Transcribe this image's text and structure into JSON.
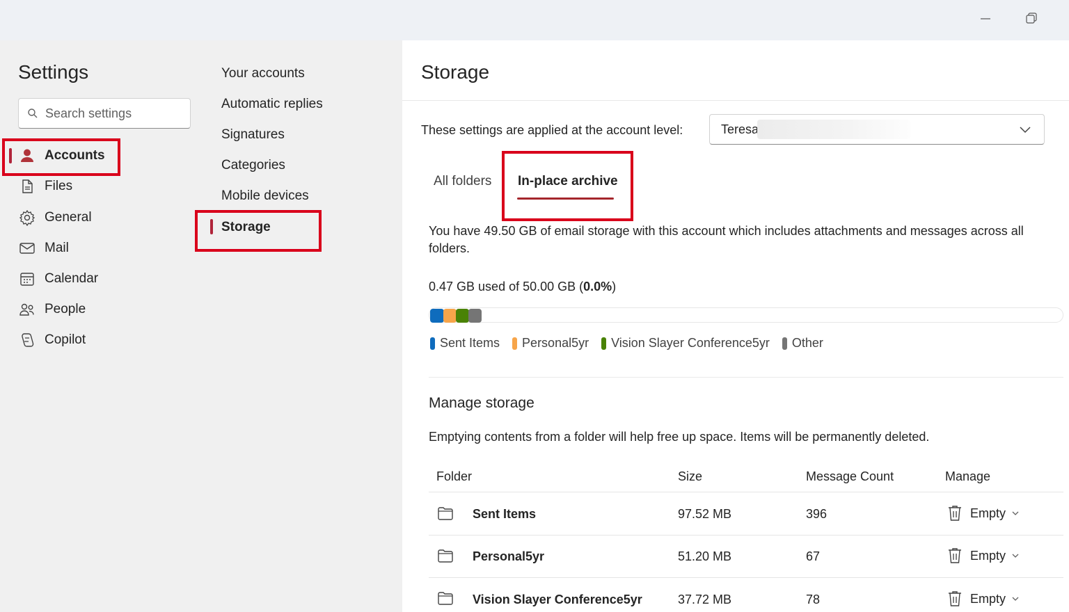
{
  "window": {
    "minimize_icon": "minimize-icon",
    "maximize_icon": "restore-icon"
  },
  "sidebar": {
    "title": "Settings",
    "search_placeholder": "Search settings",
    "items": [
      {
        "label": "Accounts",
        "icon": "person-icon",
        "selected": true
      },
      {
        "label": "Files",
        "icon": "document-icon"
      },
      {
        "label": "General",
        "icon": "gear-icon"
      },
      {
        "label": "Mail",
        "icon": "mail-icon"
      },
      {
        "label": "Calendar",
        "icon": "calendar-icon"
      },
      {
        "label": "People",
        "icon": "people-icon"
      },
      {
        "label": "Copilot",
        "icon": "copilot-icon"
      }
    ]
  },
  "subnav": {
    "items": [
      {
        "label": "Your accounts"
      },
      {
        "label": "Automatic replies"
      },
      {
        "label": "Signatures"
      },
      {
        "label": "Categories"
      },
      {
        "label": "Mobile devices"
      },
      {
        "label": "Storage",
        "selected": true
      }
    ]
  },
  "main": {
    "title": "Storage",
    "account_label": "These settings are applied at the account level:",
    "account_value": "Teresa",
    "tabs": [
      {
        "label": "All folders"
      },
      {
        "label": "In-place archive",
        "selected": true
      }
    ],
    "description": "You have 49.50 GB of email storage with this account which includes attachments and messages across all folders.",
    "usage": {
      "prefix": "0.47 GB used of 50.00 GB (",
      "percent": "0.0%",
      "suffix": ")"
    },
    "usage_bar": {
      "segments": [
        {
          "name": "Sent Items",
          "color": "#0f6cbd"
        },
        {
          "name": "Personal5yr",
          "color": "#f7a54a"
        },
        {
          "name": "Vision Slayer Conference5yr",
          "color": "#498205"
        },
        {
          "name": "Other",
          "color": "#757575"
        }
      ]
    },
    "manage": {
      "title": "Manage storage",
      "description": "Emptying contents from a folder will help free up space. Items will be permanently deleted.",
      "columns": [
        "Folder",
        "Size",
        "Message Count",
        "Manage"
      ],
      "rows": [
        {
          "folder": "Sent Items",
          "size": "97.52 MB",
          "count": "396",
          "action": "Empty"
        },
        {
          "folder": "Personal5yr",
          "size": "51.20 MB",
          "count": "67",
          "action": "Empty"
        },
        {
          "folder": "Vision Slayer Conference5yr",
          "size": "37.72 MB",
          "count": "78",
          "action": "Empty"
        }
      ]
    }
  },
  "colors": {
    "accent": "#a4262c",
    "highlight_box": "#d9001b",
    "selection_bar": "#b0243a"
  }
}
